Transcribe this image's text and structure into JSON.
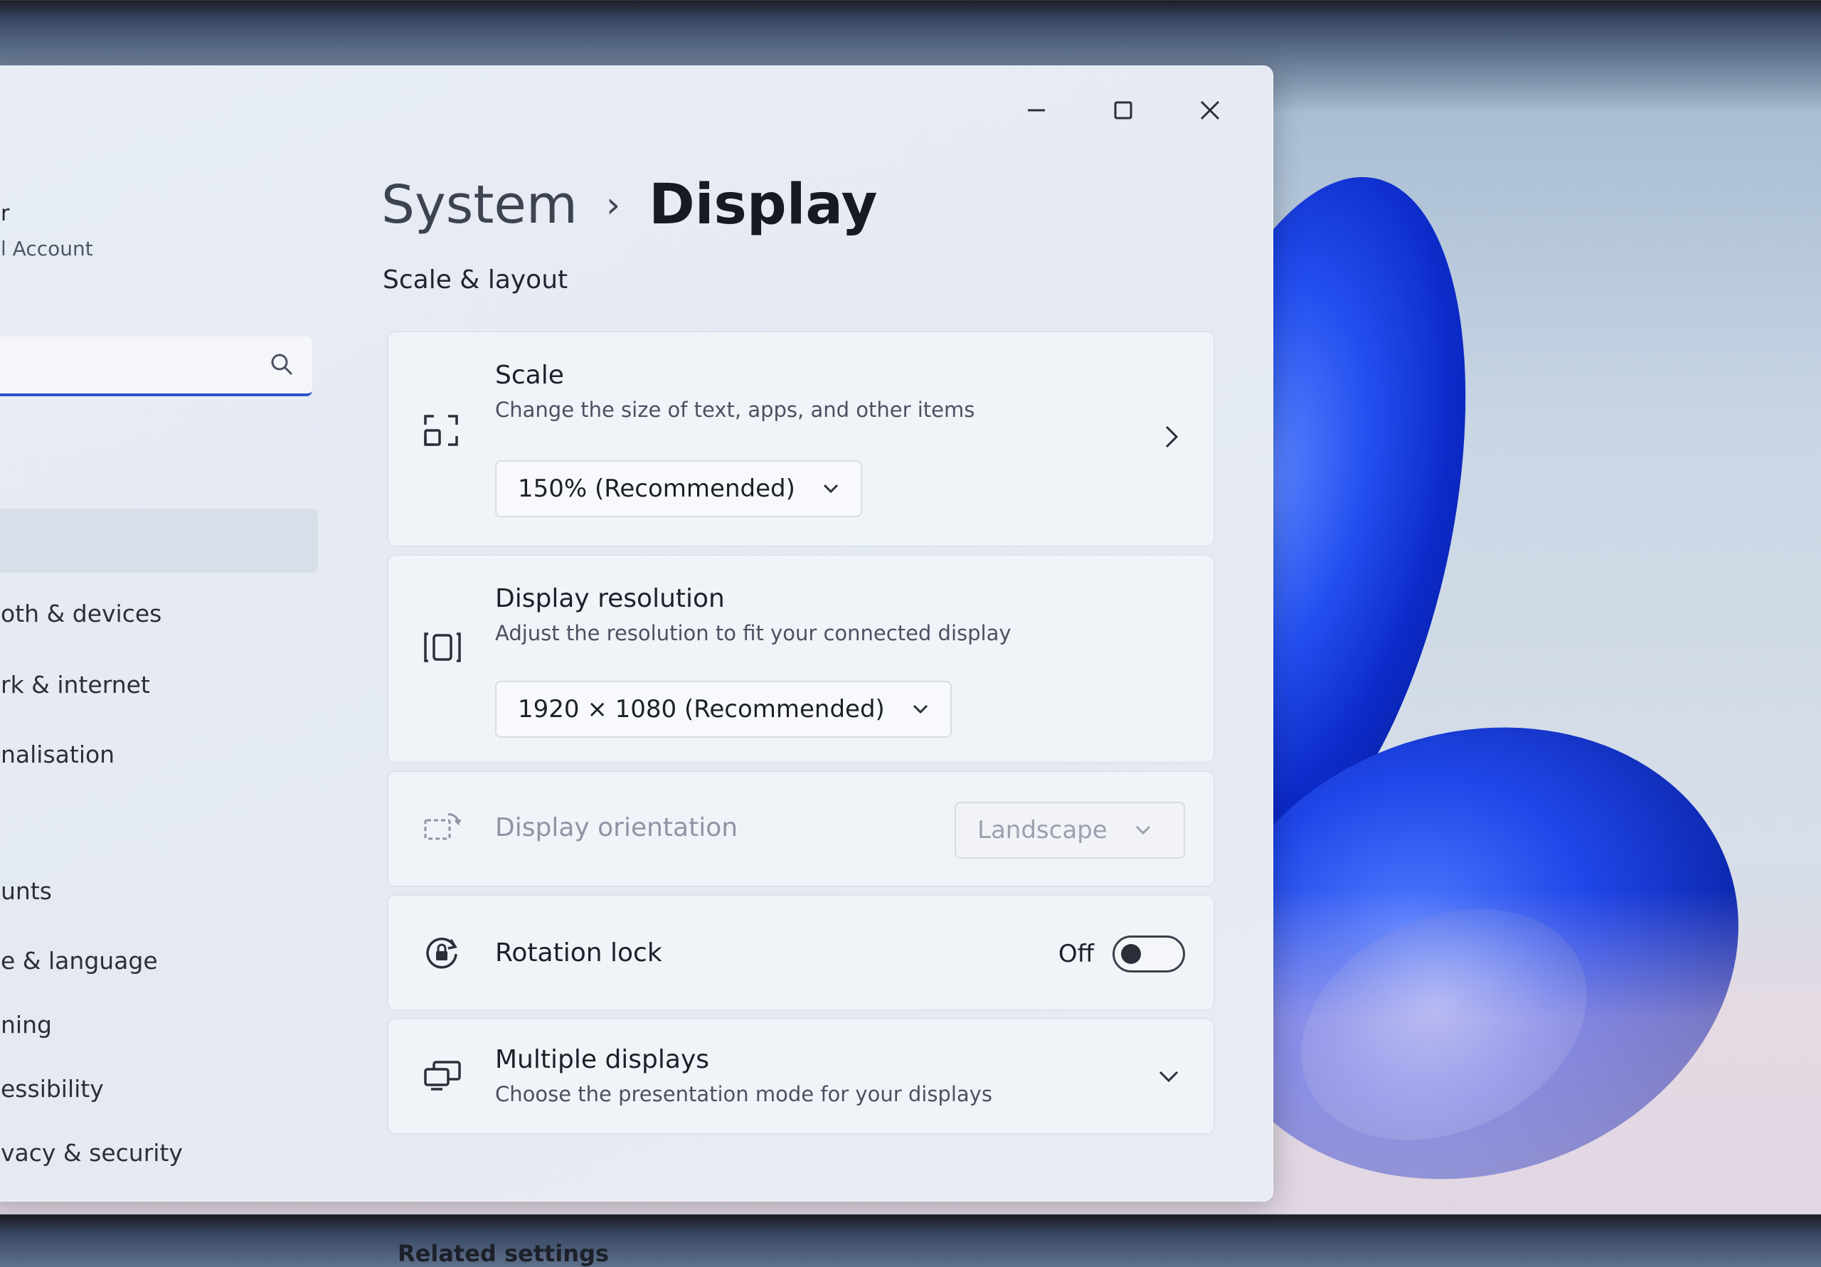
{
  "window": {
    "controls": [
      "minimize",
      "maximize",
      "close"
    ]
  },
  "nav": {
    "account_line1": "r",
    "account_line2": "l Account",
    "search_placeholder": "",
    "items": [
      {
        "label": "oth & devices"
      },
      {
        "label": "rk & internet"
      },
      {
        "label": "nalisation"
      },
      {
        "label": "unts"
      },
      {
        "label": "e & language"
      },
      {
        "label": "ning"
      },
      {
        "label": "essibility"
      },
      {
        "label": "vacy & security"
      }
    ]
  },
  "breadcrumb": {
    "parent": "System",
    "separator": "›",
    "current": "Display"
  },
  "section": {
    "title": "Scale & layout"
  },
  "scale": {
    "title": "Scale",
    "description": "Change the size of text, apps, and other items",
    "value": "150% (Recommended)"
  },
  "resolution": {
    "title": "Display resolution",
    "description": "Adjust the resolution to fit your connected display",
    "value": "1920 × 1080 (Recommended)"
  },
  "orientation": {
    "title": "Display orientation",
    "value": "Landscape",
    "enabled": false
  },
  "rotation_lock": {
    "title": "Rotation lock",
    "state_label": "Off",
    "on": false
  },
  "multiple_displays": {
    "title": "Multiple displays",
    "description": "Choose the presentation mode for your displays"
  },
  "related_settings": {
    "title": "Related settings"
  },
  "colors": {
    "accent": "#2a55c8",
    "wallpaper_blue": "#1f46e8"
  }
}
